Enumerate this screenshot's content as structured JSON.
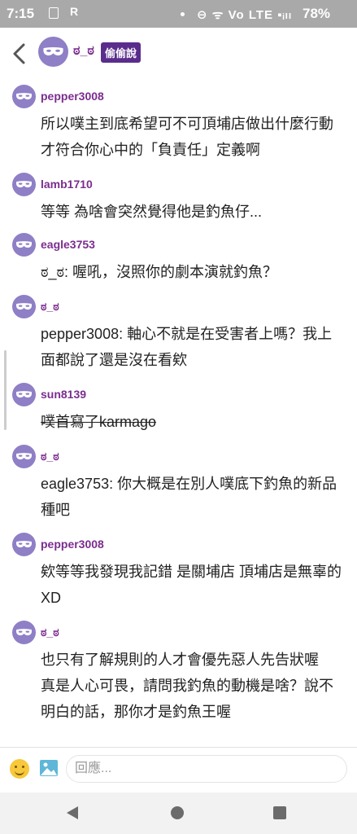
{
  "status_bar": {
    "time": "7:15",
    "icons_left": [
      "sim-card-icon",
      "r-notification-icon"
    ],
    "icons_right": "⊖ ᯤ Vo LTE ▪ᵢₗₗ",
    "battery": "78%"
  },
  "header": {
    "title": "ಠ_ಠ",
    "tag": "偷偷說"
  },
  "comments": [
    {
      "user": "pepper3008",
      "text": "所以噗主到底希望可不可頂埔店做出什麼行動 才符合你心中的「負責任」定義啊"
    },
    {
      "user": "lamb1710",
      "text": "等等 為啥會突然覺得他是釣魚仔..."
    },
    {
      "user": "eagle3753",
      "text": "ಠ_ಠ: 喔吼，沒照你的劇本演就釣魚？"
    },
    {
      "user": "ಠ_ಠ",
      "text": "pepper3008: 軸心不就是在受害者上嗎？我上面都說了還是沒在看欸"
    },
    {
      "user": "sun8139",
      "text": "噗首寫了karmago"
    },
    {
      "user": "ಠ_ಠ",
      "text": "eagle3753: 你大概是在別人噗底下釣魚的新品種吧"
    },
    {
      "user": "pepper3008",
      "text": "欸等等我發現我記錯 是關埔店 頂埔店是無辜的XD"
    },
    {
      "user": "ಠ_ಠ",
      "text_lines": [
        "也只有了解規則的人才會優先惡人先告狀喔",
        "真是人心可畏，請問我釣魚的動機是啥？說不明白的話，那你才是釣魚王喔"
      ]
    }
  ],
  "input": {
    "placeholder": "回應..."
  },
  "colors": {
    "username": "#7b2d8e",
    "tag_bg": "#5a2d8c",
    "avatar_bg": "#8e7fc6",
    "status_bar": "#a9a9a9"
  }
}
